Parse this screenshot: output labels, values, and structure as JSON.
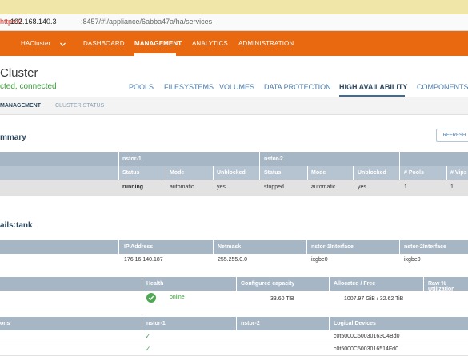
{
  "browser": {
    "url_scheme": "https://",
    "url_host": "192.168.140.3",
    "url_path": ":8457/#!/appliance/6abba47a/ha/services"
  },
  "nav": {
    "cluster_name": "HACluster",
    "items": [
      "DASHBOARD",
      "MANAGEMENT",
      "ANALYTICS",
      "ADMINISTRATION"
    ],
    "active": "MANAGEMENT"
  },
  "header": {
    "title": "Cluster",
    "status": "cted, connected",
    "tabs": [
      "POOLS",
      "FILESYSTEMS",
      "VOLUMES",
      "DATA PROTECTION",
      "HIGH AVAILABILITY",
      "COMPONENTS"
    ],
    "active_tab": "HIGH AVAILABILITY"
  },
  "subtabs": {
    "items": [
      "MANAGEMENT",
      "CLUSTER STATUS"
    ],
    "active": "MANAGEMENT"
  },
  "summary": {
    "title": "mmary",
    "refresh_label": "REFRESH",
    "group_headers": [
      "nstor-1",
      "nstor-2"
    ],
    "columns": [
      "Status",
      "Mode",
      "Unblocked",
      "Status",
      "Mode",
      "Unblocked",
      "# Pools",
      "# Vips"
    ],
    "row": [
      "running",
      "automatic",
      "yes",
      "stopped",
      "automatic",
      "yes",
      "1",
      "1"
    ]
  },
  "details": {
    "title": "ails:tank",
    "network": {
      "columns": [
        "IP Address",
        "Netmask",
        "nstor-1Interface",
        "nstor-2Interface"
      ],
      "row": [
        "176.16.140.187",
        "255.255.0.0",
        "ixgbe0",
        "ixgbe0"
      ]
    },
    "pool": {
      "columns": [
        "Health",
        "Configured capacity",
        "Allocated / Free",
        "Raw % Utilization"
      ],
      "row": [
        "online",
        "33.60 TiB",
        "1007.97 GiB / 32.62 TiB",
        ""
      ]
    },
    "devices": {
      "columns": [
        "ons",
        "nstor-1",
        "nstor-2",
        "Logical Devices"
      ],
      "rows": [
        [
          "✓",
          "c0t5000C50030163C4Bd0"
        ],
        [
          "✓",
          "c0t5000C5003016514Fd0"
        ]
      ]
    }
  },
  "colors": {
    "brand_orange": "#e8690f",
    "table_header": "#a7b6c5",
    "online_green": "#4caa52",
    "link_blue": "#4a78a8"
  }
}
